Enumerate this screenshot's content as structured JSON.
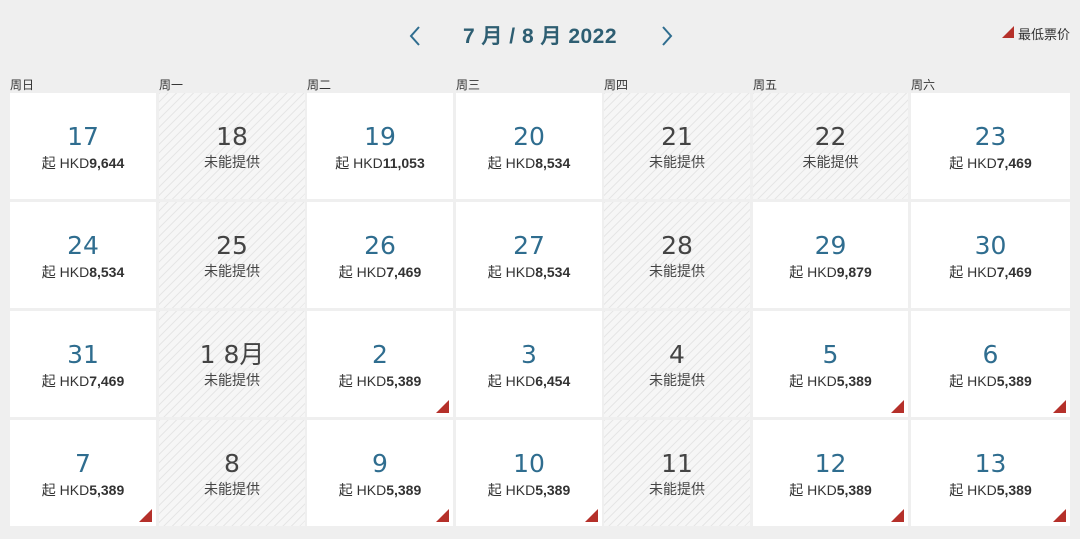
{
  "header": {
    "title": "7 月 / 8 月 2022",
    "prev_icon": "chevron-left-icon",
    "next_icon": "chevron-right-icon",
    "legend_label": "最低票价"
  },
  "colors": {
    "accent": "#2f6d8f",
    "title": "#2e5e72",
    "flag": "#b5302a"
  },
  "weekdays": [
    "周日",
    "周一",
    "周二",
    "周三",
    "周四",
    "周五",
    "周六"
  ],
  "price_prefix": "起 HKD",
  "unavailable_label": "未能提供",
  "weeks": [
    [
      {
        "day": "17",
        "price": "9,644"
      },
      {
        "day": "18",
        "price": null
      },
      {
        "day": "19",
        "price": "11,053"
      },
      {
        "day": "20",
        "price": "8,534"
      },
      {
        "day": "21",
        "price": null
      },
      {
        "day": "22",
        "price": null
      },
      {
        "day": "23",
        "price": "7,469"
      }
    ],
    [
      {
        "day": "24",
        "price": "8,534"
      },
      {
        "day": "25",
        "price": null
      },
      {
        "day": "26",
        "price": "7,469"
      },
      {
        "day": "27",
        "price": "8,534"
      },
      {
        "day": "28",
        "price": null
      },
      {
        "day": "29",
        "price": "9,879"
      },
      {
        "day": "30",
        "price": "7,469"
      }
    ],
    [
      {
        "day": "31",
        "price": "7,469"
      },
      {
        "day": "1 8月",
        "price": null
      },
      {
        "day": "2",
        "price": "5,389",
        "lowest": true
      },
      {
        "day": "3",
        "price": "6,454"
      },
      {
        "day": "4",
        "price": null
      },
      {
        "day": "5",
        "price": "5,389",
        "lowest": true
      },
      {
        "day": "6",
        "price": "5,389",
        "lowest": true
      }
    ],
    [
      {
        "day": "7",
        "price": "5,389",
        "lowest": true
      },
      {
        "day": "8",
        "price": null
      },
      {
        "day": "9",
        "price": "5,389",
        "lowest": true
      },
      {
        "day": "10",
        "price": "5,389",
        "lowest": true
      },
      {
        "day": "11",
        "price": null
      },
      {
        "day": "12",
        "price": "5,389",
        "lowest": true
      },
      {
        "day": "13",
        "price": "5,389",
        "lowest": true
      }
    ]
  ]
}
